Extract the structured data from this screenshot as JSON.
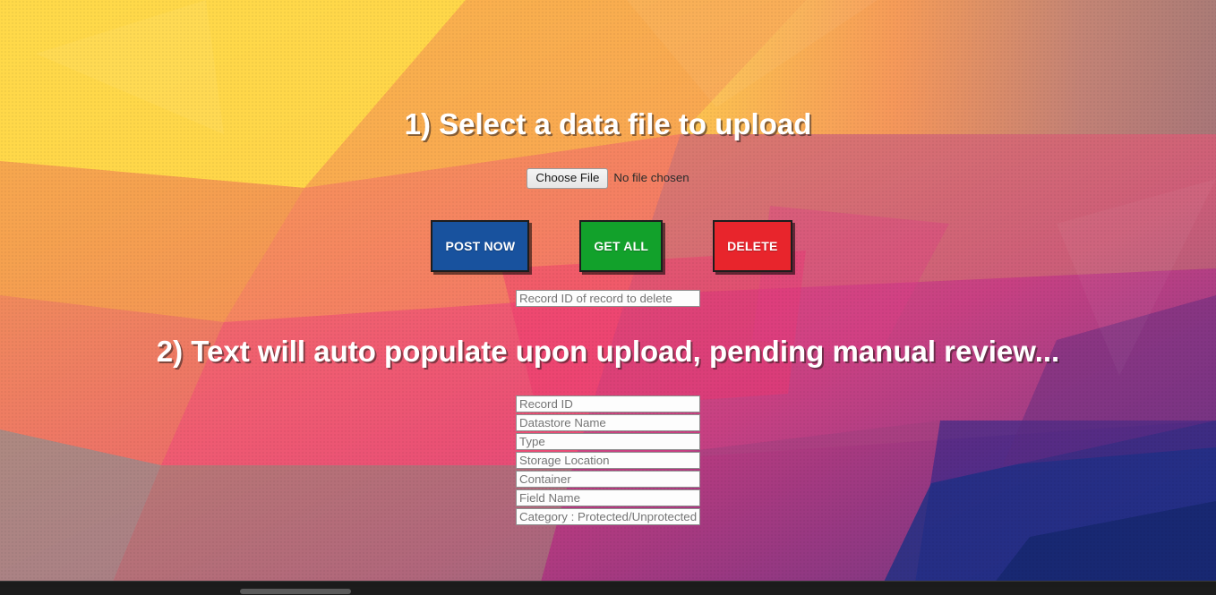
{
  "page": {
    "background_colors": {
      "top_left": "#ffd84a",
      "top_mid": "#f7a84f",
      "top_right": "#a08878",
      "center": "#ef5d72",
      "center_pink": "#e83a74",
      "mid_left": "#f07a62",
      "bottom_left": "#9a8a86",
      "bottom_mid": "#a8497f",
      "bottom_right": "#1c3082",
      "deep_purple": "#51277d"
    }
  },
  "headings": {
    "step_one": "1) Select a data file to upload",
    "step_two": "2) Text will auto populate upon upload, pending manual review..."
  },
  "file_upload": {
    "button_label": "Choose File",
    "status_text": "No file chosen"
  },
  "actions": [
    {
      "label": "POST NOW",
      "color": "#18529e",
      "name": "post-now-button"
    },
    {
      "label": "GET ALL",
      "color": "#12a12b",
      "name": "get-all-button"
    },
    {
      "label": "DELETE",
      "color": "#e8252c",
      "name": "delete-button"
    }
  ],
  "delete_input": {
    "placeholder": "Record ID of record to delete",
    "value": ""
  },
  "record_fields": [
    {
      "placeholder": "Record ID",
      "value": "",
      "name": "record-id-input"
    },
    {
      "placeholder": "Datastore Name",
      "value": "",
      "name": "datastore-name-input"
    },
    {
      "placeholder": "Type",
      "value": "",
      "name": "type-input"
    },
    {
      "placeholder": "Storage Location",
      "value": "",
      "name": "storage-location-input"
    },
    {
      "placeholder": "Container",
      "value": "",
      "name": "container-input"
    },
    {
      "placeholder": "Field Name",
      "value": "",
      "name": "field-name-input"
    },
    {
      "placeholder": "Category : Protected/Unprotected",
      "value": "",
      "name": "category-input"
    }
  ]
}
